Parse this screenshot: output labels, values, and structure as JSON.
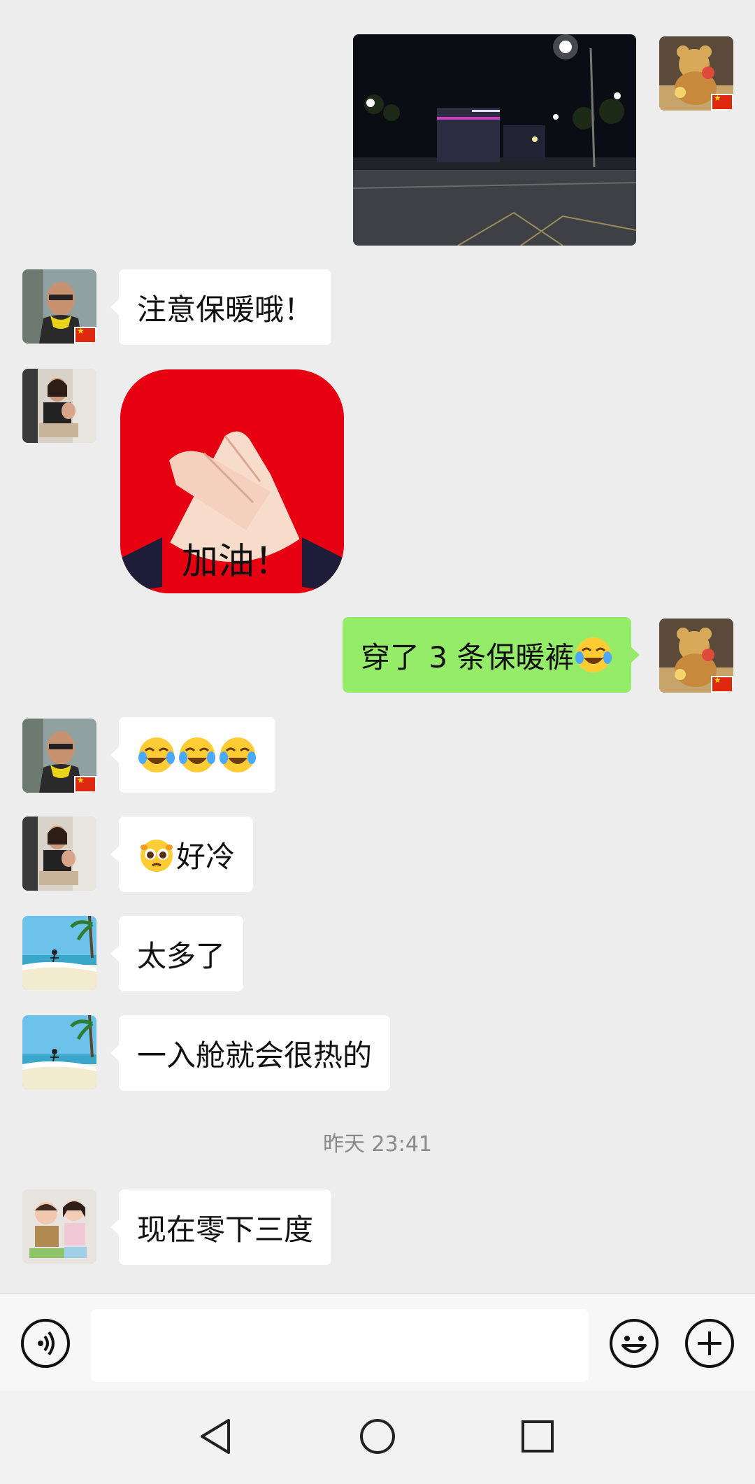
{
  "chat": {
    "messages": [
      {
        "id": "m1",
        "side": "right",
        "type": "image",
        "sender": "me",
        "image": "night-street-photo"
      },
      {
        "id": "m2",
        "side": "left",
        "type": "text",
        "sender": "man-sunglasses",
        "text": "注意保暖哦！"
      },
      {
        "id": "m3",
        "side": "left",
        "type": "sticker",
        "sender": "woman-child",
        "text": "加油！"
      },
      {
        "id": "m4",
        "side": "right",
        "type": "text",
        "sender": "me",
        "text": "穿了 3 条保暖裤",
        "emoji": "crying-laughing-emoji"
      },
      {
        "id": "m5",
        "side": "left",
        "type": "emoji",
        "sender": "man-sunglasses",
        "emoji": [
          "crying-laughing-emoji",
          "crying-laughing-emoji",
          "crying-laughing-emoji"
        ]
      },
      {
        "id": "m6",
        "side": "left",
        "type": "text",
        "sender": "woman-child",
        "emoji": "pleading-face-emoji",
        "text": "好冷"
      },
      {
        "id": "m7",
        "side": "left",
        "type": "text",
        "sender": "beach-avatar",
        "text": "太多了"
      },
      {
        "id": "m8",
        "side": "left",
        "type": "text",
        "sender": "beach-avatar",
        "text": "一入舱就会很热的"
      },
      {
        "id": "m9",
        "side": "left",
        "type": "text",
        "sender": "two-kids",
        "text": "现在零下三度"
      }
    ],
    "timestamp": "昨天 23:41"
  },
  "input_bar": {
    "voice_icon": "voice-icon",
    "input_value": "",
    "emoji_icon": "smiley-icon",
    "plus_icon": "plus-icon"
  },
  "nav_bar": {
    "back": "back-triangle-icon",
    "home": "home-circle-icon",
    "recents": "recents-square-icon"
  },
  "colors": {
    "background": "#ededed",
    "my_bubble": "#95ec69",
    "other_bubble": "#ffffff",
    "timestamp": "#8a8a8a"
  }
}
